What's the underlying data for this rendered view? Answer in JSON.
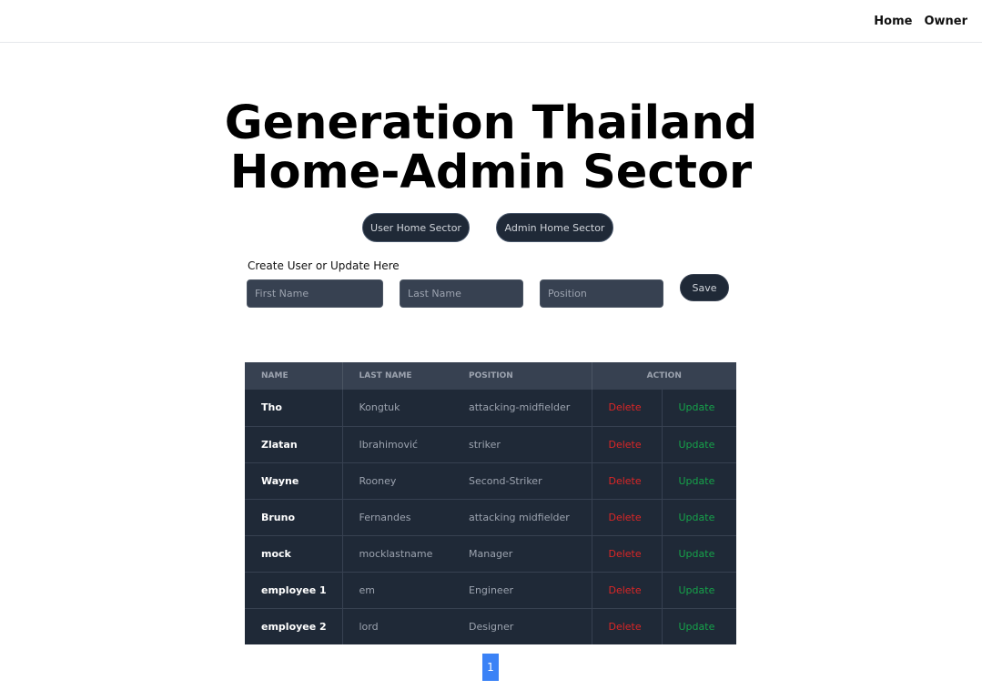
{
  "nav": {
    "links": [
      "Home",
      "Owner"
    ]
  },
  "hero": {
    "title_line1": "Generation Thailand",
    "title_line2": "Home-Admin Sector"
  },
  "sector_buttons": {
    "user": "User Home Sector",
    "admin": "Admin Home Sector"
  },
  "form": {
    "label": "Create User or Update Here",
    "first_name": {
      "value": "",
      "placeholder": "First Name"
    },
    "last_name": {
      "value": "",
      "placeholder": "Last Name"
    },
    "position": {
      "value": "",
      "placeholder": "Position"
    },
    "save_label": "Save"
  },
  "table": {
    "headers": {
      "name": "Name",
      "last_name": "Last Name",
      "position": "Position",
      "action": "Action"
    },
    "delete_label": "Delete",
    "update_label": "Update",
    "rows": [
      {
        "name": "Tho",
        "last_name": "Kongtuk",
        "position": "attacking-midfielder"
      },
      {
        "name": "Zlatan",
        "last_name": "Ibrahimović",
        "position": "striker"
      },
      {
        "name": "Wayne",
        "last_name": "Rooney",
        "position": "Second-Striker"
      },
      {
        "name": "Bruno",
        "last_name": "Fernandes",
        "position": "attacking midfielder"
      },
      {
        "name": "mock",
        "last_name": "mocklastname",
        "position": "Manager"
      },
      {
        "name": "employee 1",
        "last_name": "em",
        "position": "Engineer"
      },
      {
        "name": "employee 2",
        "last_name": "lord",
        "position": "Designer"
      }
    ]
  },
  "pagination": {
    "current_page": "1"
  },
  "colors": {
    "table_bg": "#1f2937",
    "table_header_bg": "#374151",
    "delete": "#dc2626",
    "update": "#16a34a",
    "pager": "#3b82f6"
  }
}
